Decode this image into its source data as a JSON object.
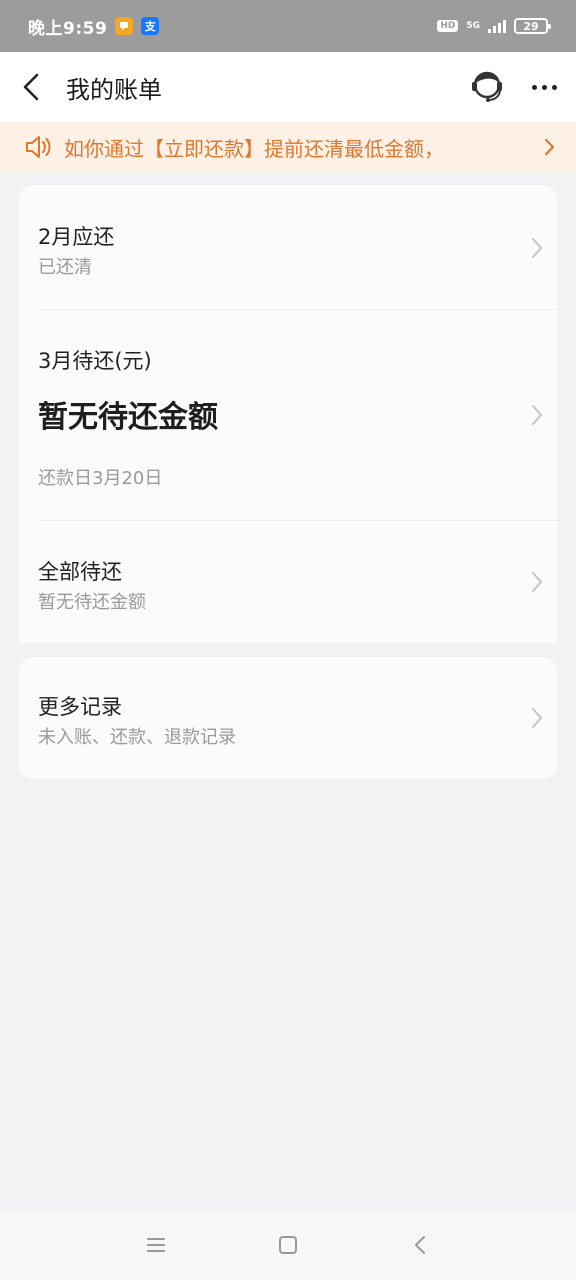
{
  "status_bar": {
    "time": "晚上9:59",
    "notification_app_color": "#f5a623",
    "alipay_app_label": "支",
    "alipay_app_color": "#1677ff",
    "hd_label": "HD",
    "network_label": "5G",
    "battery_level": "29"
  },
  "nav": {
    "title": "我的账单",
    "back_icon": "chevron-left-icon",
    "service_icon": "customer-service-icon",
    "more_icon": "more-dots-icon"
  },
  "notice": {
    "text": "如你通过【立即还款】提前还清最低金额，",
    "color": "#e2762d",
    "background": "#fdf1e6"
  },
  "bill_card": {
    "feb": {
      "title": "2月应还",
      "status": "已还清"
    },
    "mar": {
      "title": "3月待还(元)",
      "amount": "暂无待还金额",
      "due_date": "还款日3月20日"
    },
    "all": {
      "title": "全部待还",
      "status": "暂无待还金额"
    }
  },
  "more_records": {
    "title": "更多记录",
    "subtitle": "未入账、还款、退款记录"
  },
  "system_nav": {
    "menu_icon": "menu-icon",
    "home_icon": "home-square-icon",
    "back_icon": "back-triangle-icon"
  }
}
